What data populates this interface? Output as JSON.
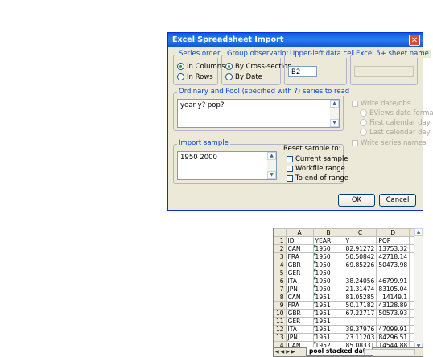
{
  "dialog": {
    "title": "Excel Spreadsheet Import",
    "close_icon": "close-icon",
    "series_order": {
      "label": "Series order",
      "options": [
        "In Columns",
        "In Rows"
      ],
      "selected": "In Columns"
    },
    "group_observations": {
      "label": "Group observations",
      "options": [
        "By Cross-section",
        "By Date"
      ],
      "selected": "By Cross-section"
    },
    "upper_left": {
      "label": "Upper-left data cell",
      "value": "B2"
    },
    "sheet_name": {
      "label": "Excel 5+ sheet name",
      "value": ""
    },
    "series_to_read": {
      "label": "Ordinary and Pool (specified with ?) series to read",
      "value": "year y? pop?"
    },
    "write_date_obs": {
      "label": "Write date/obs",
      "options": [
        "EViews date format",
        "First calendar day",
        "Last calendar day"
      ]
    },
    "write_series_names": "Write series names",
    "import_sample": {
      "label": "Import sample",
      "value": "1950 2000"
    },
    "reset_sample": {
      "label": "Reset sample to:",
      "options": [
        "Current sample",
        "Workfile range",
        "To end of range"
      ]
    },
    "ok_label": "OK",
    "cancel_label": "Cancel"
  },
  "sheet": {
    "columns": [
      "A",
      "B",
      "C",
      "D"
    ],
    "rows": [
      {
        "n": "1",
        "a": "ID",
        "b": "YEAR",
        "c": "Y",
        "d": "POP"
      },
      {
        "n": "2",
        "a": "CAN",
        "b": "1950",
        "c": "82.91272",
        "d": "13753.32"
      },
      {
        "n": "3",
        "a": "FRA",
        "b": "1950",
        "c": "50.50842",
        "d": "42718.14"
      },
      {
        "n": "4",
        "a": "GBR",
        "b": "1950",
        "c": "69.85226",
        "d": "50473.98"
      },
      {
        "n": "5",
        "a": "GER",
        "b": "1950",
        "c": "",
        "d": ""
      },
      {
        "n": "6",
        "a": "ITA",
        "b": "1950",
        "c": "38.24056",
        "d": "46799.91"
      },
      {
        "n": "7",
        "a": "JPN",
        "b": "1950",
        "c": "21.31474",
        "d": "83105.04"
      },
      {
        "n": "8",
        "a": "CAN",
        "b": "1951",
        "c": "81.05285",
        "d": "14149.1"
      },
      {
        "n": "9",
        "a": "FRA",
        "b": "1951",
        "c": "50.17182",
        "d": "43128.89"
      },
      {
        "n": "10",
        "a": "GBR",
        "b": "1951",
        "c": "67.22717",
        "d": "50573.93"
      },
      {
        "n": "11",
        "a": "GER",
        "b": "1951",
        "c": "",
        "d": ""
      },
      {
        "n": "12",
        "a": "ITA",
        "b": "1951",
        "c": "39.37976",
        "d": "47099.91"
      },
      {
        "n": "13",
        "a": "JPN",
        "b": "1951",
        "c": "23.11203",
        "d": "84296.51"
      },
      {
        "n": "14",
        "a": "CAN",
        "b": "1952",
        "c": "85.08331",
        "d": "14544.88"
      }
    ],
    "tab_label": "pool stacked date"
  }
}
